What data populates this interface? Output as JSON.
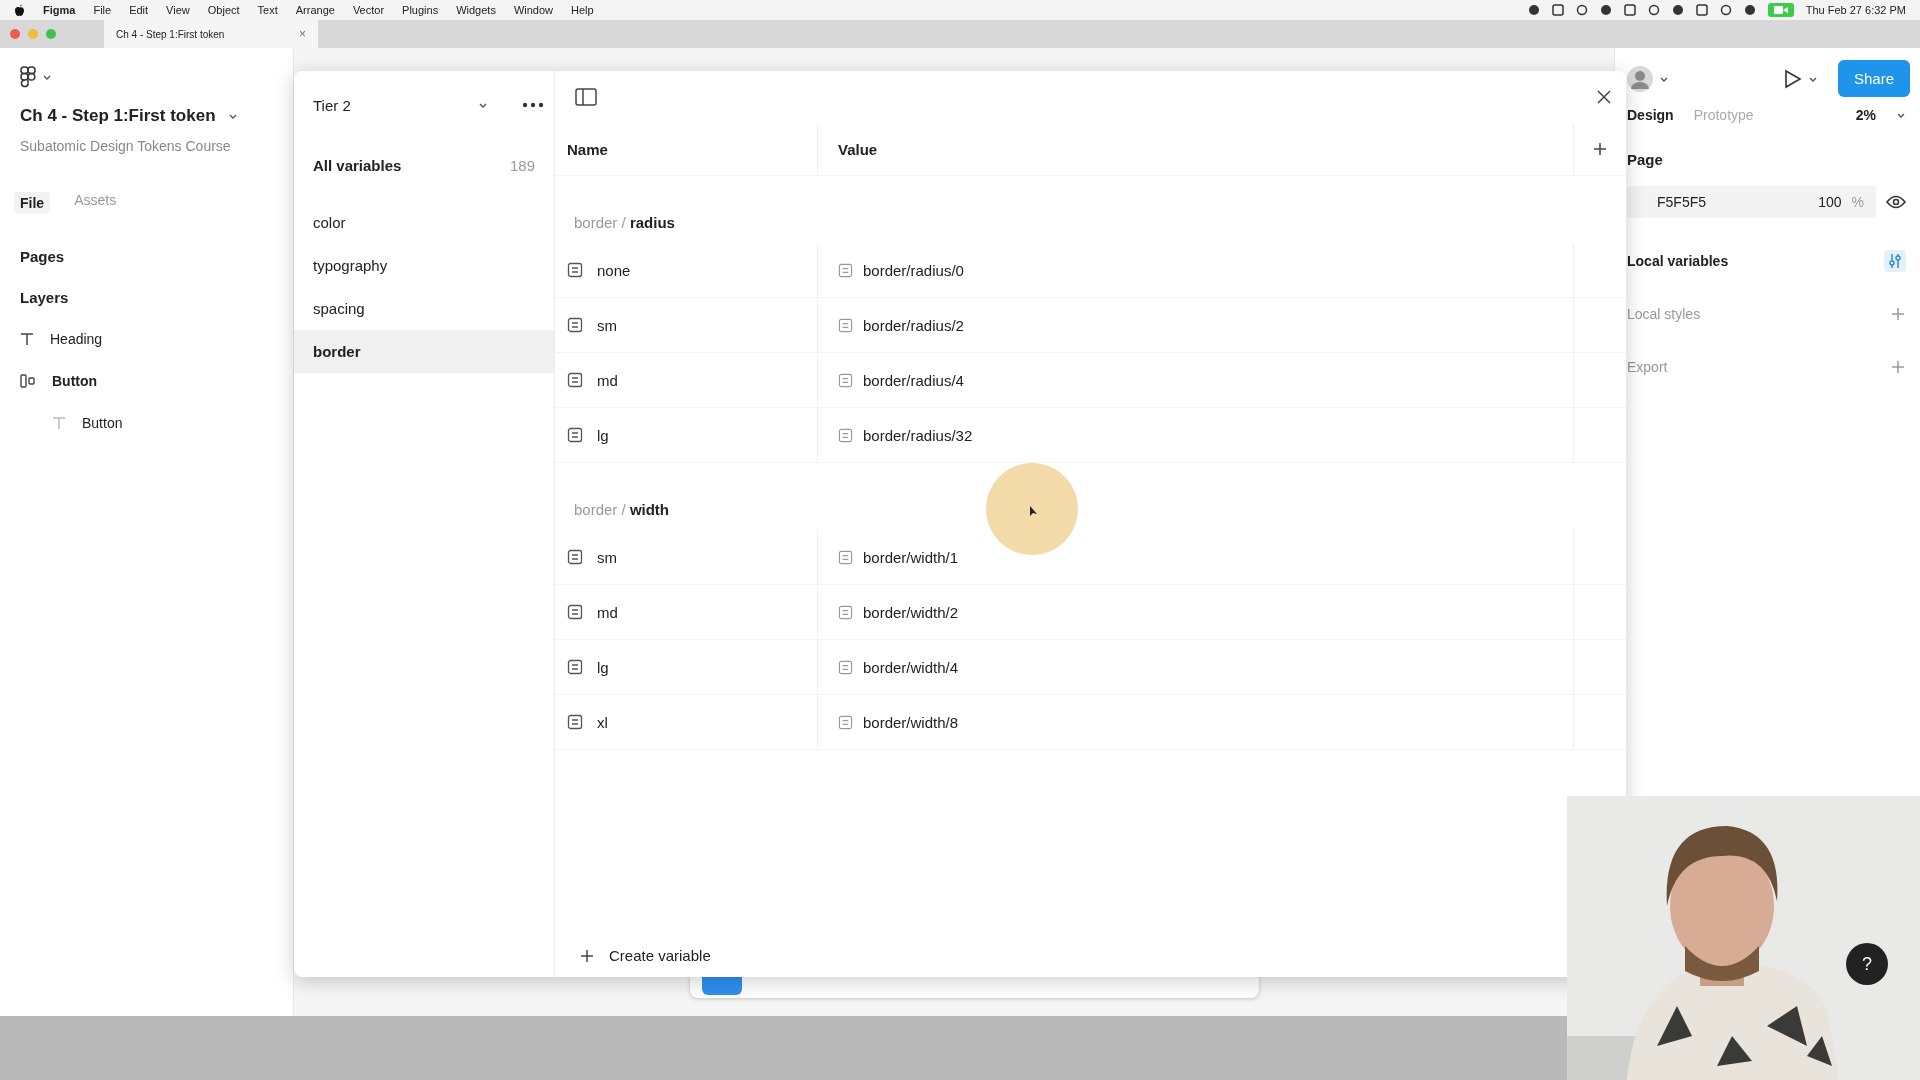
{
  "menu_bar": {
    "app": "Figma",
    "items": [
      "File",
      "Edit",
      "View",
      "Object",
      "Text",
      "Arrange",
      "Vector",
      "Plugins",
      "Widgets",
      "Window",
      "Help"
    ],
    "clock": "Thu Feb 27  6:32 PM"
  },
  "browser_tab": {
    "title": "Ch 4 - Step 1:First token",
    "close": "×"
  },
  "left_panel": {
    "file_title": "Ch 4 - Step 1:First token",
    "subtitle": "Subatomic Design Tokens Course",
    "tabs": [
      {
        "label": "File",
        "selected": true
      },
      {
        "label": "Assets",
        "selected": false
      }
    ],
    "pages_label": "Pages",
    "layers_label": "Layers",
    "layers": [
      {
        "label": "Heading",
        "kind": "text"
      },
      {
        "label": "Button",
        "kind": "frame",
        "children": [
          {
            "label": "Button",
            "kind": "text"
          }
        ]
      }
    ]
  },
  "variables_modal": {
    "collection": "Tier 2",
    "all_variables": {
      "label": "All variables",
      "count": "189"
    },
    "groups": [
      {
        "label": "color",
        "selected": false
      },
      {
        "label": "typography",
        "selected": false
      },
      {
        "label": "spacing",
        "selected": false
      },
      {
        "label": "border",
        "selected": true
      }
    ],
    "columns": [
      "Name",
      "Value"
    ],
    "sections": [
      {
        "prefix": "border /",
        "name": "radius",
        "rows": [
          {
            "name": "none",
            "value": "border/radius/0"
          },
          {
            "name": "sm",
            "value": "border/radius/2"
          },
          {
            "name": "md",
            "value": "border/radius/4"
          },
          {
            "name": "lg",
            "value": "border/radius/32"
          }
        ]
      },
      {
        "prefix": "border /",
        "name": "width",
        "rows": [
          {
            "name": "sm",
            "value": "border/width/1"
          },
          {
            "name": "md",
            "value": "border/width/2"
          },
          {
            "name": "lg",
            "value": "border/width/4"
          },
          {
            "name": "xl",
            "value": "border/width/8"
          }
        ]
      }
    ],
    "create_label": "Create variable"
  },
  "right_panel": {
    "share": "Share",
    "tabs": [
      {
        "label": "Design",
        "selected": true
      },
      {
        "label": "Prototype",
        "selected": false
      }
    ],
    "zoom": "2%",
    "page_label": "Page",
    "fill_hex": "F5F5F5",
    "fill_opacity": "100",
    "percent": "%",
    "sections": [
      {
        "label": "Local variables",
        "kind": "active"
      },
      {
        "label": "Local styles",
        "kind": "add"
      },
      {
        "label": "Export",
        "kind": "add"
      }
    ]
  },
  "help": "?"
}
